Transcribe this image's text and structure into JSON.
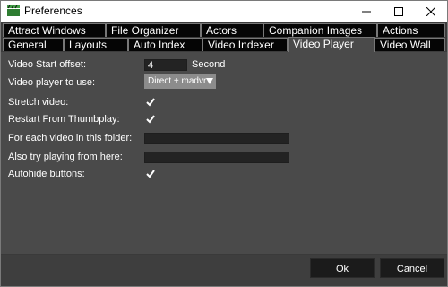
{
  "window": {
    "title": "Preferences"
  },
  "tabs": {
    "row1": [
      "Attract Windows",
      "File Organizer",
      "Actors",
      "Companion Images",
      "Actions"
    ],
    "row2": [
      "General",
      "Layouts",
      "Auto Index",
      "Video Indexer",
      "Video Player",
      "Video Wall"
    ],
    "active": "Video Player"
  },
  "form": {
    "start_offset": {
      "label": "Video Start offset:",
      "value": "4",
      "unit": "Second"
    },
    "player": {
      "label": "Video player to use:",
      "value": "Direct + madvr"
    },
    "stretch": {
      "label": "Stretch video:",
      "checked": true
    },
    "restart": {
      "label": "Restart From Thumbplay:",
      "checked": true
    },
    "each_video": {
      "label": "For each video in this folder:",
      "value": ""
    },
    "also_try": {
      "label": "Also try playing from here:",
      "value": ""
    },
    "autohide": {
      "label": "Autohide buttons:",
      "checked": true
    }
  },
  "buttons": {
    "ok": "Ok",
    "cancel": "Cancel"
  },
  "colors": {
    "background": "#4a4a4a",
    "tab_inactive": "#050505",
    "input_bg": "#232323",
    "select_bg": "#8c8c8c"
  },
  "icons": [
    "clapperboard-icon",
    "minimize-icon",
    "maximize-icon",
    "close-icon",
    "checkmark-icon",
    "dropdown-caret-icon"
  ]
}
